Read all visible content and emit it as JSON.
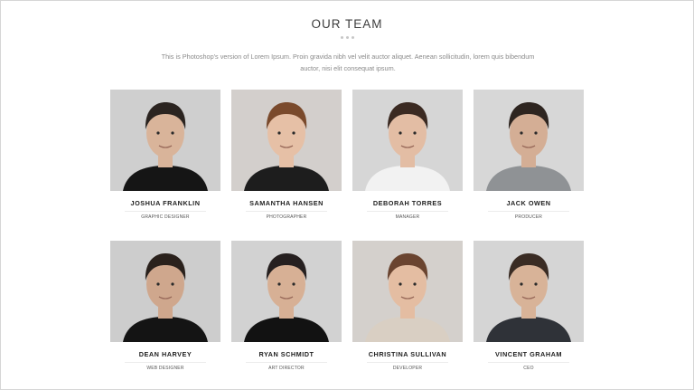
{
  "section": {
    "title": "OUR TEAM",
    "intro_line1": "This is Photoshop's version of Lorem Ipsum. Proin gravida nibh vel velit auctor aliquet. Aenean sollicitudin, lorem quis bibendum",
    "intro_line2": "auctor, nisi elit consequat ipsum."
  },
  "team": [
    {
      "name": "JOSHUA FRANKLIN",
      "role": "GRAPHIC DESIGNER",
      "hair": "#2b2420",
      "skin": "#d9b49a",
      "shirt": "#151515",
      "bg": "#cfcfcf"
    },
    {
      "name": "SAMANTHA HANSEN",
      "role": "PHOTOGRAPHER",
      "hair": "#7a4a2c",
      "skin": "#e6c0a6",
      "shirt": "#1d1d1d",
      "bg": "#d3cfcc"
    },
    {
      "name": "DEBORAH TORRES",
      "role": "MANAGER",
      "hair": "#3b2a22",
      "skin": "#e3bda4",
      "shirt": "#f2f2f2",
      "bg": "#d6d6d6"
    },
    {
      "name": "JACK OWEN",
      "role": "PRODUCER",
      "hair": "#2e2520",
      "skin": "#d4ae95",
      "shirt": "#8f9295",
      "bg": "#d7d7d7"
    },
    {
      "name": "DEAN HARVEY",
      "role": "WEB DESIGNER",
      "hair": "#2a211c",
      "skin": "#cfa78d",
      "shirt": "#141414",
      "bg": "#cdcdcd"
    },
    {
      "name": "RYAN SCHMIDT",
      "role": "ART DIRECTOR",
      "hair": "#262020",
      "skin": "#d7b095",
      "shirt": "#121212",
      "bg": "#d2d2d2"
    },
    {
      "name": "CHRISTINA SULLIVAN",
      "role": "DEVELOPER",
      "hair": "#6a4430",
      "skin": "#e4bda2",
      "shirt": "#d9cfc3",
      "bg": "#d4d0cc"
    },
    {
      "name": "VINCENT GRAHAM",
      "role": "CEO",
      "hair": "#3a2c24",
      "skin": "#d8b398",
      "shirt": "#2f3238",
      "bg": "#d5d5d5"
    }
  ]
}
